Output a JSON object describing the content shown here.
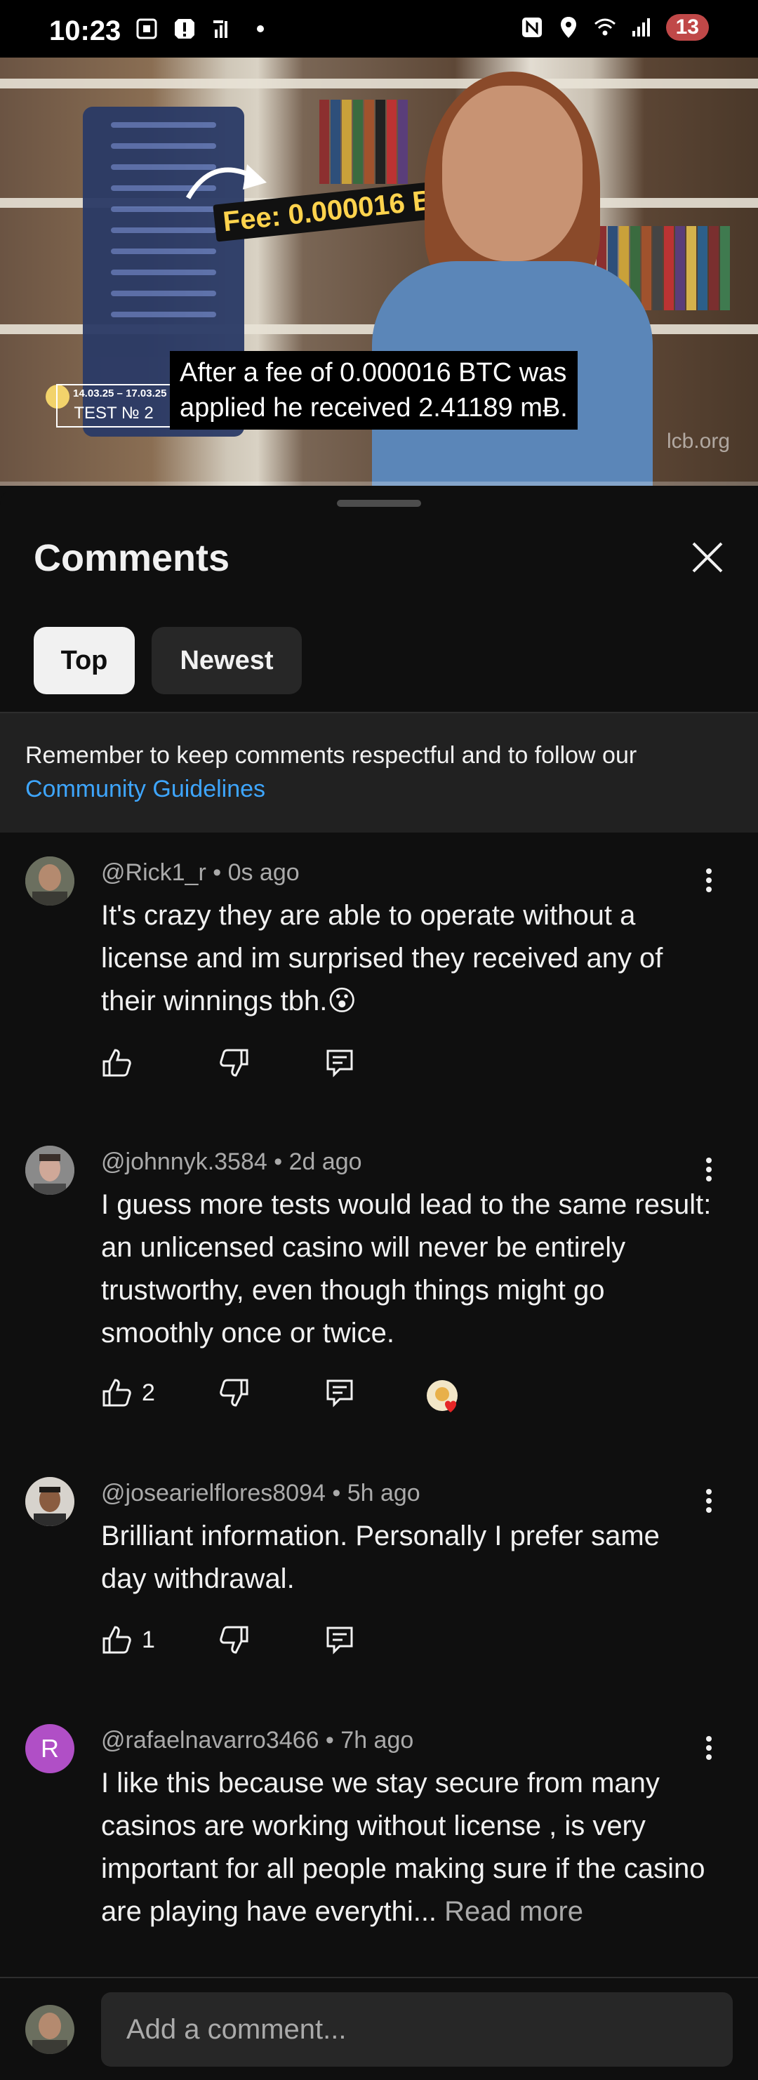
{
  "status_bar": {
    "time": "10:23",
    "battery": "13",
    "icons": [
      "screenshot-icon",
      "alert-icon",
      "signal-tower-icon",
      "dot-icon",
      "nfc-icon",
      "location-icon",
      "wifi-icon",
      "cell-signal-icon"
    ]
  },
  "video": {
    "fee_overlay": "Fee: 0.000016 BTC",
    "caption_line1": "After a fee of 0.000016 BTC was",
    "caption_line2": "applied he received 2.41189 mɃ.",
    "test_dates": "14.03.25 – 17.03.25",
    "test_label": "TEST № 2",
    "watermark": "lcb.org"
  },
  "sheet": {
    "title": "Comments",
    "tabs": [
      {
        "label": "Top",
        "selected": true
      },
      {
        "label": "Newest",
        "selected": false
      }
    ],
    "notice": {
      "text": "Remember to keep comments respectful and to follow our",
      "link": "Community Guidelines"
    }
  },
  "comments": [
    {
      "author": "@Rick1_r",
      "time": "0s ago",
      "text": "It's crazy they are able to operate without a license and im surprised they received any of their winnings tbh.😮",
      "likes": ""
    },
    {
      "author": "@johnnyk.3584",
      "time": "2d ago",
      "text": "I guess more tests would lead to the same result: an unlicensed casino will never be entirely trustworthy, even though things might go smoothly once or twice.",
      "likes": "2"
    },
    {
      "author": "@josearielflores8094",
      "time": "5h ago",
      "text": "Brilliant information.  Personally I prefer same day withdrawal.",
      "likes": "1"
    },
    {
      "author": "@rafaelnavarro3466",
      "time": "7h ago",
      "avatar_letter": "R",
      "avatar_color": "#b04fc6",
      "text": "I like this because we stay secure from many casinos are working without license , is very important for all people making sure if the casino are playing have everythi...",
      "read_more": "Read more",
      "likes": ""
    }
  ],
  "composer": {
    "placeholder": "Add a comment..."
  },
  "colors": {
    "background": "#0f0f0f",
    "link": "#3ea6ff",
    "chip_selected": "#f1f1f1",
    "chip_unselected": "#272727"
  }
}
